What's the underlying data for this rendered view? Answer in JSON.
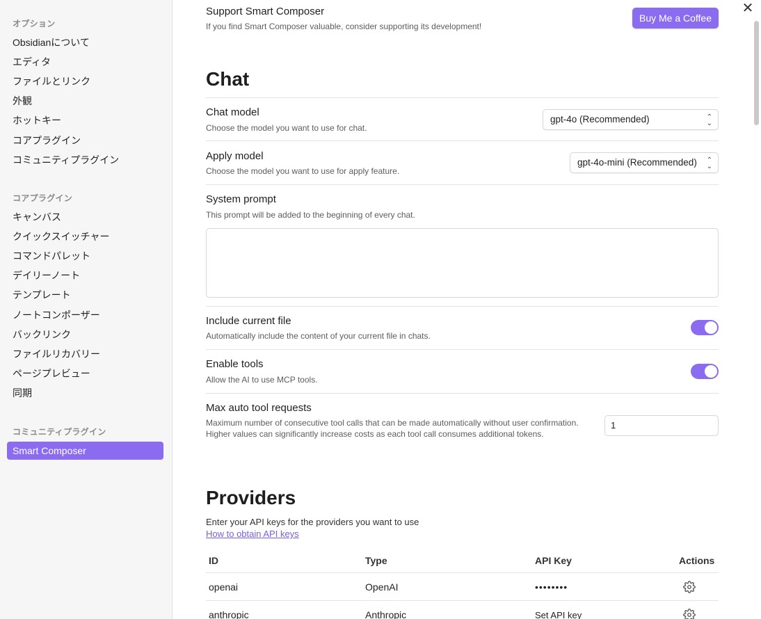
{
  "sidebar": {
    "sections": [
      {
        "title": "オプション",
        "items": [
          "Obsidianについて",
          "エディタ",
          "ファイルとリンク",
          "外観",
          "ホットキー",
          "コアプラグイン",
          "コミュニティプラグイン"
        ]
      },
      {
        "title": "コアプラグイン",
        "items": [
          "キャンバス",
          "クイックスイッチャー",
          "コマンドパレット",
          "デイリーノート",
          "テンプレート",
          "ノートコンポーザー",
          "バックリンク",
          "ファイルリカバリー",
          "ページプレビュー",
          "同期"
        ]
      },
      {
        "title": "コミュニティプラグイン",
        "items": [
          "Smart Composer"
        ]
      }
    ],
    "active_item": "Smart Composer"
  },
  "support": {
    "title": "Support Smart Composer",
    "desc": "If you find Smart Composer valuable, consider supporting its development!",
    "button": "Buy Me a Coffee"
  },
  "chat": {
    "heading": "Chat",
    "chat_model": {
      "name": "Chat model",
      "desc": "Choose the model you want to use for chat.",
      "value": "gpt-4o (Recommended)"
    },
    "apply_model": {
      "name": "Apply model",
      "desc": "Choose the model you want to use for apply feature.",
      "value": "gpt-4o-mini (Recommended)"
    },
    "system_prompt": {
      "name": "System prompt",
      "desc": "This prompt will be added to the beginning of every chat.",
      "value": ""
    },
    "include_current_file": {
      "name": "Include current file",
      "desc": "Automatically include the content of your current file in chats.",
      "enabled": true
    },
    "enable_tools": {
      "name": "Enable tools",
      "desc": "Allow the AI to use MCP tools.",
      "enabled": true
    },
    "max_auto_tool_requests": {
      "name": "Max auto tool requests",
      "desc": "Maximum number of consecutive tool calls that can be made automatically without user confirmation. Higher values can significantly increase costs as each tool call consumes additional tokens.",
      "value": "1"
    }
  },
  "providers": {
    "heading": "Providers",
    "desc": "Enter your API keys for the providers you want to use",
    "link": "How to obtain API keys",
    "columns": [
      "ID",
      "Type",
      "API Key",
      "Actions"
    ],
    "rows": [
      {
        "id": "openai",
        "type": "OpenAI",
        "api_key": "••••••••"
      },
      {
        "id": "anthropic",
        "type": "Anthropic",
        "api_key": "Set API key"
      }
    ]
  },
  "colors": {
    "accent": "#8b6cf0",
    "sidebar_bg": "#f6f6f6"
  },
  "icons": {
    "close": "close-icon",
    "select_chevron": "chevron-updown-icon",
    "row_action": "gear-icon"
  }
}
